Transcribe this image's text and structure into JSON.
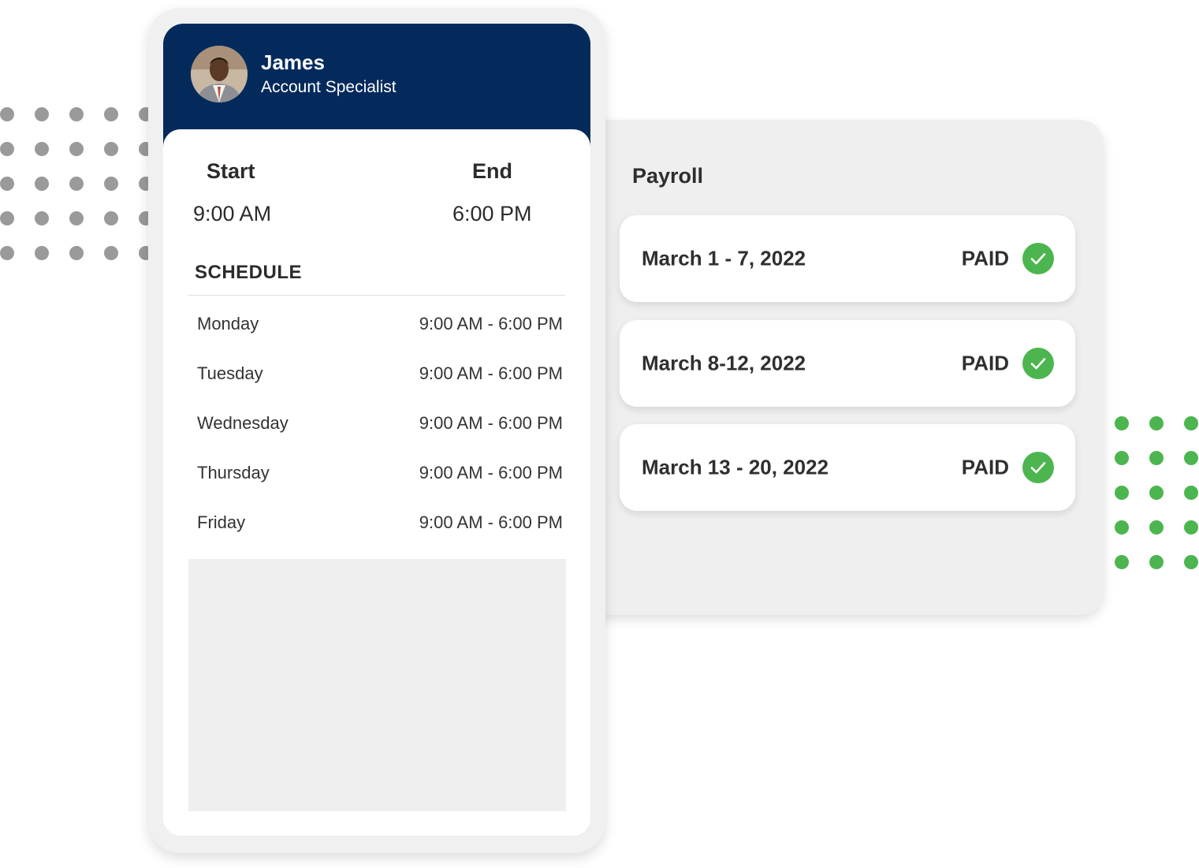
{
  "colors": {
    "header_navy": "#042a5c",
    "paid_green": "#4db54f",
    "dot_gray": "#9a9a9a",
    "panel_gray": "#efefef"
  },
  "profile": {
    "name": "James",
    "role": "Account Specialist",
    "avatar_icon": "person-photo"
  },
  "shift": {
    "start_label": "Start",
    "end_label": "End",
    "start_time": "9:00 AM",
    "end_time": "6:00 PM"
  },
  "schedule": {
    "heading": "SCHEDULE",
    "days": [
      {
        "day": "Monday",
        "hours": "9:00 AM - 6:00 PM"
      },
      {
        "day": "Tuesday",
        "hours": "9:00 AM - 6:00 PM"
      },
      {
        "day": "Wednesday",
        "hours": "9:00 AM - 6:00 PM"
      },
      {
        "day": "Thursday",
        "hours": "9:00 AM - 6:00 PM"
      },
      {
        "day": "Friday",
        "hours": "9:00 AM - 6:00 PM"
      }
    ]
  },
  "payroll": {
    "title": "Payroll",
    "entries": [
      {
        "period": "March 1 - 7, 2022",
        "status": "PAID",
        "icon": "check-circle-icon"
      },
      {
        "period": "March 8-12, 2022",
        "status": "PAID",
        "icon": "check-circle-icon"
      },
      {
        "period": "March 13 - 20, 2022",
        "status": "PAID",
        "icon": "check-circle-icon"
      }
    ]
  }
}
